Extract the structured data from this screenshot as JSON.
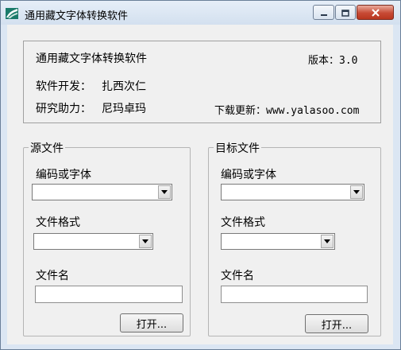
{
  "window": {
    "title": "通用藏文字体转换软件"
  },
  "info": {
    "app_name": "通用藏文字体转换软件",
    "version": "版本：3.0",
    "developer_label": "软件开发：",
    "developer": "扎西次仁",
    "assistant_label": "研究助力：",
    "assistant": "尼玛卓玛",
    "download": "下载更新：www.yalasoo.com"
  },
  "source": {
    "group_label": "源文件",
    "encoding_label": "编码或字体",
    "encoding_value": "",
    "format_label": "文件格式",
    "format_value": "",
    "filename_label": "文件名",
    "filename_value": "",
    "open_button": "打开..."
  },
  "target": {
    "group_label": "目标文件",
    "encoding_label": "编码或字体",
    "encoding_value": "",
    "format_label": "文件格式",
    "format_value": "",
    "filename_label": "文件名",
    "filename_value": "",
    "open_button": "打开..."
  },
  "colors": {
    "window_frame": "#dbe6f3",
    "client_bg": "#f0f0f0",
    "close_button": "#c74a35"
  },
  "icons": [
    "app-logo-icon",
    "minimize-icon",
    "maximize-icon",
    "close-icon",
    "chevron-down-icon"
  ]
}
